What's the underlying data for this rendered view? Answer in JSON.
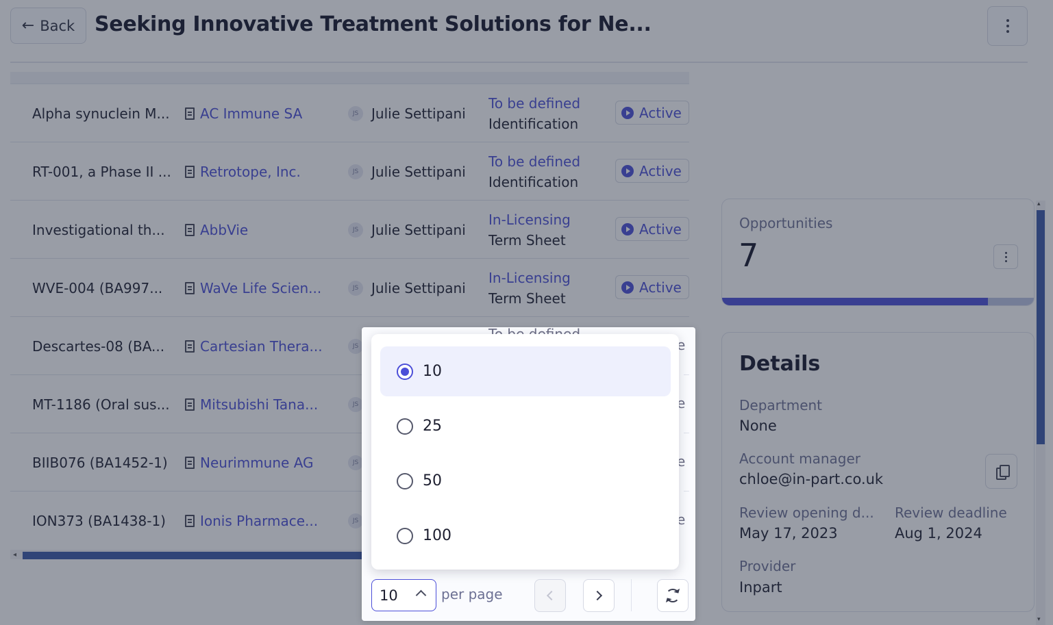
{
  "header": {
    "back_label": "Back",
    "title": "Seeking Innovative Treatment Solutions for Ne..."
  },
  "table": {
    "rows": [
      {
        "name": "Alpha synuclein M...",
        "company": "AC Immune SA",
        "owner_initials": "JS",
        "owner": "Julie Settipani",
        "stage_type": "To be defined",
        "stage": "Identification",
        "status": "Active"
      },
      {
        "name": "RT-001, a Phase II ...",
        "company": "Retrotope, Inc.",
        "owner_initials": "JS",
        "owner": "Julie Settipani",
        "stage_type": "To be defined",
        "stage": "Identification",
        "status": "Active"
      },
      {
        "name": "Investigational th...",
        "company": "AbbVie",
        "owner_initials": "JS",
        "owner": "Julie Settipani",
        "stage_type": "In-Licensing",
        "stage": "Term Sheet",
        "status": "Active"
      },
      {
        "name": "WVE-004 (BA997...",
        "company": "WaVe Life Scien...",
        "owner_initials": "JS",
        "owner": "Julie Settipani",
        "stage_type": "In-Licensing",
        "stage": "Term Sheet",
        "status": "Active"
      },
      {
        "name": "Descartes-08 (BA...",
        "company": "Cartesian Thera...",
        "owner_initials": "JS"
      },
      {
        "name": "MT-1186 (Oral sus...",
        "company": "Mitsubishi Tana...",
        "owner_initials": "JS"
      },
      {
        "name": "BIIB076 (BA1452-1)",
        "company": "Neurimmune AG",
        "owner_initials": "JS"
      },
      {
        "name": "ION373 (BA1438-1)",
        "company": "Ionis Pharmace...",
        "owner_initials": "JS"
      }
    ]
  },
  "opportunities": {
    "label": "Opportunities",
    "value": "7",
    "progress": 0.85
  },
  "details": {
    "title": "Details",
    "department_label": "Department",
    "department_value": "None",
    "account_manager_label": "Account manager",
    "account_manager_value": "chloe@in-part.co.uk",
    "review_opening_label": "Review opening d...",
    "review_opening_value": "May 17, 2023",
    "review_deadline_label": "Review deadline",
    "review_deadline_value": "Aug 1, 2024",
    "provider_label": "Provider",
    "provider_value": "Inpart"
  },
  "pagination": {
    "options": [
      "10",
      "25",
      "50",
      "100"
    ],
    "selected": "10",
    "per_page_label": "per page",
    "partial_stage_text": "To be defined",
    "partial_status_fragment": "e"
  },
  "colors": {
    "accent": "#4b4ed8",
    "overlay": "#262e42",
    "link": "#4a4fd6"
  }
}
